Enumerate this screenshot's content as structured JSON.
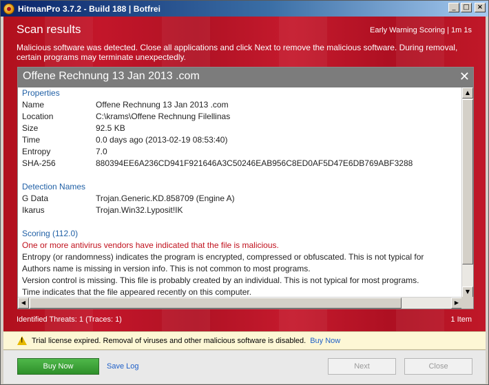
{
  "window": {
    "title": "HitmanPro 3.7.2 - Build 188 | Botfrei"
  },
  "header": {
    "title": "Scan results",
    "info": "Early Warning Scoring  |  1m 1s",
    "warning": "Malicious software was detected. Close all applications and click Next to remove the malicious software. During removal, certain programs may terminate unexpectedly."
  },
  "panel": {
    "title": "Offene Rechnung 13 Jan 2013 .com",
    "properties_heading": "Properties",
    "properties": [
      {
        "key": "Name",
        "value": "Offene Rechnung 13 Jan 2013 .com"
      },
      {
        "key": "Location",
        "value": "C:\\krams\\Offene Rechnung Filellinas"
      },
      {
        "key": "Size",
        "value": "92.5 KB"
      },
      {
        "key": "Time",
        "value": "0.0 days ago (2013-02-19 08:53:40)"
      },
      {
        "key": "Entropy",
        "value": "7.0"
      },
      {
        "key": "SHA-256",
        "value": "880394EE6A236CD941F921646A3C50246EAB956C8ED0AF5D47E6DB769ABF3288"
      }
    ],
    "detection_heading": "Detection Names",
    "detections": [
      {
        "key": "G Data",
        "value": "Trojan.Generic.KD.858709 (Engine A)"
      },
      {
        "key": "Ikarus",
        "value": "Trojan.Win32.Lyposit!IK"
      }
    ],
    "scoring_heading": "Scoring (112.0)",
    "scoring_alert": "One or more antivirus vendors have indicated that the file is malicious.",
    "scoring_lines": [
      "Entropy (or randomness) indicates the program is encrypted, compressed or obfuscated. This is not typical for",
      "Authors name is missing in version info. This is not common to most programs.",
      "Version control is missing. This file is probably created by an individual. This is not typical for most programs.",
      "Time indicates that the file appeared recently on this computer."
    ]
  },
  "status": {
    "threats": "Identified Threats: 1   (Traces: 1)",
    "items": "1 Item"
  },
  "infobar": {
    "message": "Trial license expired. Removal of viruses and other malicious software is disabled.",
    "link": "Buy Now",
    "icon": "warning-icon"
  },
  "buttons": {
    "buy": "Buy Now",
    "savelog": "Save Log",
    "next": "Next",
    "close": "Close"
  },
  "colors": {
    "accent_red": "#c3162a",
    "buy_green": "#3ea33a",
    "link_blue": "#1e5fc8",
    "section_blue": "#1f5fa5"
  }
}
